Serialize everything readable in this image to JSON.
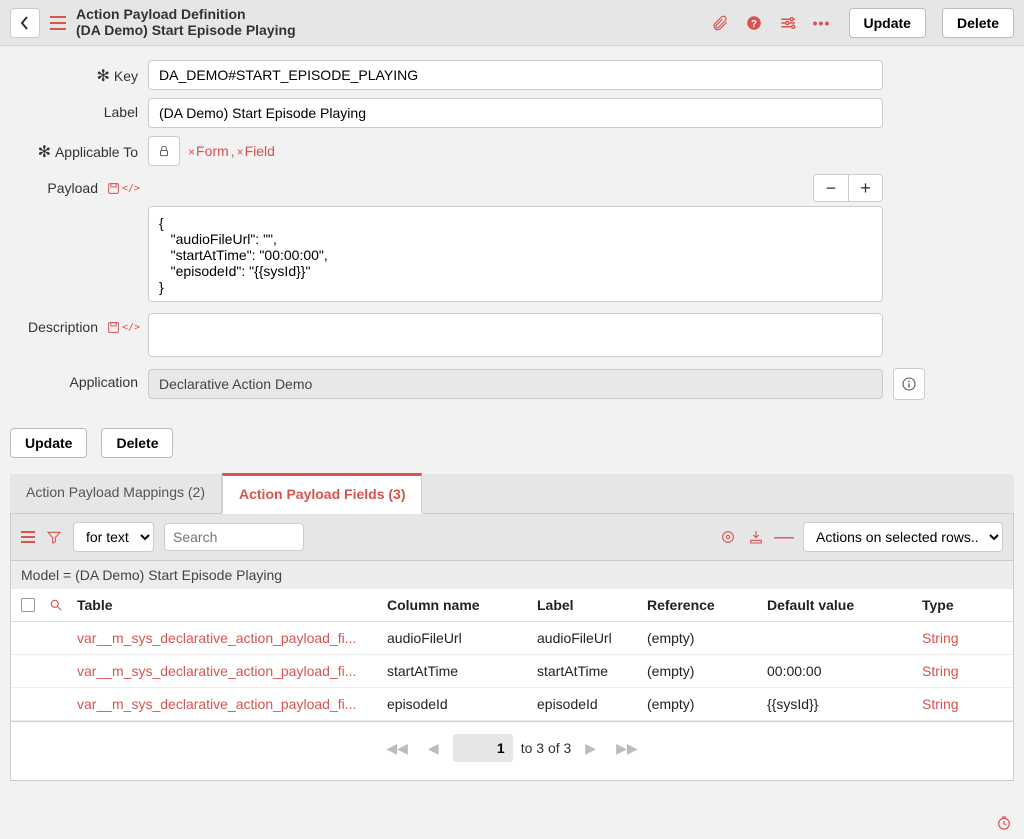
{
  "header": {
    "title": "Action Payload Definition",
    "subtitle": "(DA Demo) Start Episode Playing",
    "update_label": "Update",
    "delete_label": "Delete"
  },
  "form": {
    "key_label": "Key",
    "key_value": "DA_DEMO#START_EPISODE_PLAYING",
    "label_label": "Label",
    "label_value": "(DA Demo) Start Episode Playing",
    "applicable_to_label": "Applicable To",
    "applicable_tags": [
      {
        "label": "Form"
      },
      {
        "label": "Field"
      }
    ],
    "payload_label": "Payload",
    "payload_value": "{\n   \"audioFileUrl\": \"\",\n   \"startAtTime\": \"00:00:00\",\n   \"episodeId\": \"{{sysId}}\"\n}",
    "description_label": "Description",
    "description_value": "",
    "application_label": "Application",
    "application_value": "Declarative Action Demo"
  },
  "buttons_lower": {
    "update_label": "Update",
    "delete_label": "Delete"
  },
  "tabs": [
    {
      "label": "Action Payload Mappings (2)",
      "active": false
    },
    {
      "label": "Action Payload Fields (3)",
      "active": true
    }
  ],
  "grid_toolbar": {
    "filter_mode": "for text",
    "search_placeholder": "Search",
    "actions_placeholder": "Actions on selected rows..."
  },
  "model_bar": "Model = (DA Demo) Start Episode Playing",
  "grid": {
    "headers": {
      "table": "Table",
      "column_name": "Column name",
      "label": "Label",
      "reference": "Reference",
      "default_value": "Default value",
      "type": "Type"
    },
    "rows": [
      {
        "table": "var__m_sys_declarative_action_payload_fi...",
        "column_name": "audioFileUrl",
        "label": "audioFileUrl",
        "reference": "(empty)",
        "default_value": "",
        "type": "String"
      },
      {
        "table": "var__m_sys_declarative_action_payload_fi...",
        "column_name": "startAtTime",
        "label": "startAtTime",
        "reference": "(empty)",
        "default_value": "00:00:00",
        "type": "String"
      },
      {
        "table": "var__m_sys_declarative_action_payload_fi...",
        "column_name": "episodeId",
        "label": "episodeId",
        "reference": "(empty)",
        "default_value": "{{sysId}}",
        "type": "String"
      }
    ]
  },
  "pager": {
    "page": "1",
    "range_text": "to 3 of 3"
  }
}
